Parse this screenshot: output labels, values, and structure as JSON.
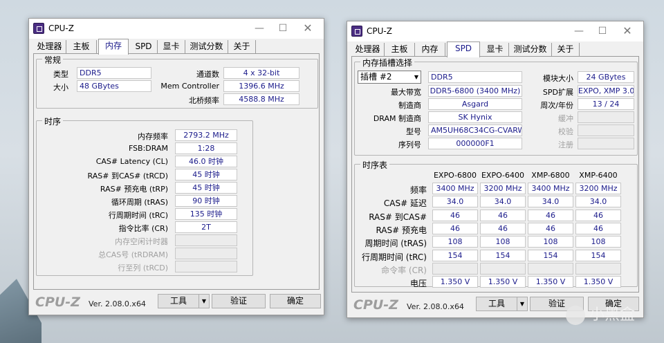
{
  "left_window": {
    "title": "CPU-Z",
    "tabs": [
      "处理器",
      "主板",
      "内存",
      "SPD",
      "显卡",
      "测试分数",
      "关于"
    ],
    "active_tab": "内存",
    "general": {
      "group_label": "常规",
      "type_label": "类型",
      "type_value": "DDR5",
      "size_label": "大小",
      "size_value": "48 GBytes",
      "channels_label": "通道数",
      "channels_value": "4 x 32-bit",
      "memctrl_label": "Mem Controller",
      "memctrl_value": "1396.6 MHz",
      "nb_label": "北桥频率",
      "nb_value": "4588.8 MHz"
    },
    "timings": {
      "group_label": "时序",
      "rows": [
        {
          "label": "内存频率",
          "value": "2793.2 MHz",
          "enabled": true
        },
        {
          "label": "FSB:DRAM",
          "value": "1:28",
          "enabled": true
        },
        {
          "label": "CAS# Latency (CL)",
          "value": "46.0 时钟",
          "enabled": true
        },
        {
          "label": "RAS# 到CAS# (tRCD)",
          "value": "45 时钟",
          "enabled": true
        },
        {
          "label": "RAS# 预充电 (tRP)",
          "value": "45 时钟",
          "enabled": true
        },
        {
          "label": "循环周期 (tRAS)",
          "value": "90 时钟",
          "enabled": true
        },
        {
          "label": "行周期时间 (tRC)",
          "value": "135 时钟",
          "enabled": true
        },
        {
          "label": "指令比率 (CR)",
          "value": "2T",
          "enabled": true
        },
        {
          "label": "内存空闲计时器",
          "value": "",
          "enabled": false
        },
        {
          "label": "总CAS号 (tRDRAM)",
          "value": "",
          "enabled": false
        },
        {
          "label": "行至列 (tRCD)",
          "value": "",
          "enabled": false
        }
      ]
    },
    "footer": {
      "logo": "CPU-Z",
      "version": "Ver. 2.08.0.x64",
      "tools_label": "工具",
      "validate_label": "验证",
      "ok_label": "确定"
    }
  },
  "right_window": {
    "title": "CPU-Z",
    "tabs": [
      "处理器",
      "主板",
      "内存",
      "SPD",
      "显卡",
      "测试分数",
      "关于"
    ],
    "active_tab": "SPD",
    "slot": {
      "group_label": "内存插槽选择",
      "slot_select": "插槽 #2",
      "type_value": "DDR5",
      "module_size_label": "模块大小",
      "module_size_value": "24 GBytes",
      "max_bw_label": "最大带宽",
      "max_bw_value": "DDR5-6800 (3400 MHz)",
      "spd_ext_label": "SPD扩展",
      "spd_ext_value": "EXPO, XMP 3.0",
      "manufacturer_label": "制造商",
      "manufacturer_value": "Asgard",
      "week_year_label": "周次/年份",
      "week_year_value": "13 / 24",
      "dram_mfr_label": "DRAM 制造商",
      "dram_mfr_value": "SK Hynix",
      "buffered_label": "缓冲",
      "buffered_value": "",
      "part_label": "型号",
      "part_value": "AM5UH68C34CG-CVARWM",
      "correction_label": "校验",
      "correction_value": "",
      "serial_label": "序列号",
      "serial_value": "000000F1",
      "registered_label": "注册",
      "registered_value": ""
    },
    "timing_table": {
      "group_label": "时序表",
      "columns": [
        "EXPO-6800",
        "EXPO-6400",
        "XMP-6800",
        "XMP-6400"
      ],
      "rows": [
        {
          "label": "频率",
          "values": [
            "3400 MHz",
            "3200 MHz",
            "3400 MHz",
            "3200 MHz"
          ],
          "enabled": true
        },
        {
          "label": "CAS# 延迟",
          "values": [
            "34.0",
            "34.0",
            "34.0",
            "34.0"
          ],
          "enabled": true
        },
        {
          "label": "RAS# 到CAS#",
          "values": [
            "46",
            "46",
            "46",
            "46"
          ],
          "enabled": true
        },
        {
          "label": "RAS# 预充电",
          "values": [
            "46",
            "46",
            "46",
            "46"
          ],
          "enabled": true
        },
        {
          "label": "周期时间 (tRAS)",
          "values": [
            "108",
            "108",
            "108",
            "108"
          ],
          "enabled": true
        },
        {
          "label": "行周期时间 (tRC)",
          "values": [
            "154",
            "154",
            "154",
            "154"
          ],
          "enabled": true
        },
        {
          "label": "命令率 (CR)",
          "values": [
            "",
            "",
            "",
            ""
          ],
          "enabled": false
        },
        {
          "label": "电压",
          "values": [
            "1.350 V",
            "1.350 V",
            "1.350 V",
            "1.350 V"
          ],
          "enabled": true
        }
      ]
    },
    "footer": {
      "logo": "CPU-Z",
      "version": "Ver. 2.08.0.x64",
      "tools_label": "工具",
      "validate_label": "验证",
      "ok_label": "确定"
    }
  },
  "watermark": {
    "text": "小黑盒"
  }
}
